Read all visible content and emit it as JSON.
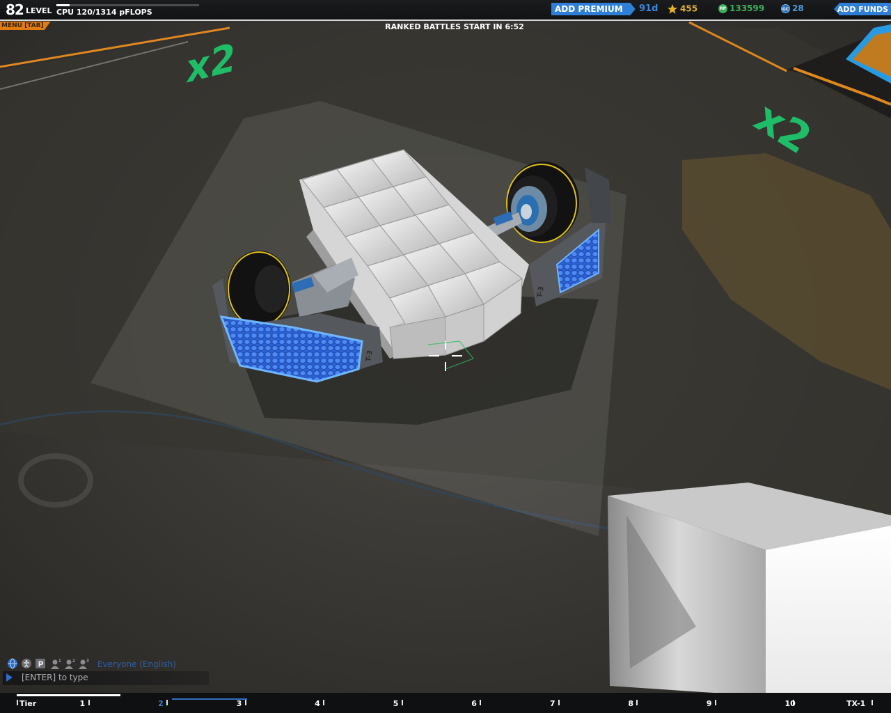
{
  "hud": {
    "level_number": "82",
    "level_label": "LEVEL",
    "cpu_text": "CPU 120/1314 pFLOPS",
    "cpu_fraction": 0.091,
    "premium_label": "ADD PREMIUM",
    "premium_days": "91d",
    "stars": "455",
    "robits": "133599",
    "galaxy_coins": "28",
    "robits_badge": "RP",
    "galaxy_badge": "GC",
    "funds_label": "ADD FUNDS",
    "menu_label": "MENU [TAB]",
    "ranked_text": "RANKED BATTLES START IN 6:52"
  },
  "scene": {
    "floor_markers": [
      "x2",
      "x2"
    ],
    "wheel_labels": [
      "T-3",
      "T-3"
    ],
    "crosshair": "crosshair-icon"
  },
  "chat": {
    "channel": "Everyone (English)",
    "input_hint": "[ENTER] to type",
    "icons": [
      "globe-icon",
      "accessibility-icon",
      "p-icon",
      "party-1-icon",
      "party-2-icon",
      "party-3-icon"
    ],
    "party_numbers": [
      "1",
      "2",
      "3"
    ]
  },
  "tiers": {
    "labels": [
      "Tier",
      "1",
      "2",
      "3",
      "4",
      "5",
      "6",
      "7",
      "8",
      "9",
      "10",
      "TX-1"
    ],
    "current_tier": "2",
    "progress_fraction": 0.12
  },
  "colors": {
    "accent_blue": "#2f7fd6",
    "menu_orange": "#e07b10",
    "stars_gold": "#e6b22a",
    "robits_green": "#3fae5a",
    "gc_blue": "#4a9ae0",
    "floor_marker_green": "#1fbd67"
  }
}
